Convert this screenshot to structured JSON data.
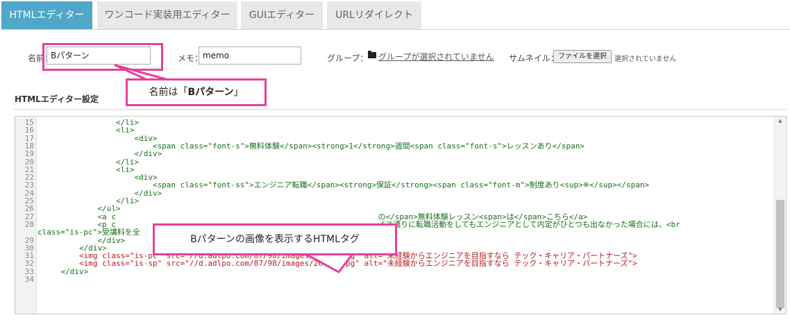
{
  "tabs": [
    {
      "label": "HTMLエディター",
      "active": true
    },
    {
      "label": "ワンコード実装用エディター",
      "active": false
    },
    {
      "label": "GUIエディター",
      "active": false
    },
    {
      "label": "URLリダイレクト",
      "active": false
    }
  ],
  "form": {
    "name_label": "名前：",
    "name_value": "Bパターン",
    "memo_label": "メモ：",
    "memo_value": "memo",
    "group_label": "グループ：",
    "group_link": "グループが選択されていません",
    "thumb_label": "サムネイル：",
    "file_button": "ファイルを選択",
    "file_status": "選択されていません"
  },
  "callouts": {
    "name_prefix": "名前は「",
    "name_bold": "Bパターン",
    "name_suffix": "」",
    "html_tag": "Bパターンの画像を表示するHTMLタグ"
  },
  "section": {
    "title": "HTMLエディター設定"
  },
  "editor": {
    "lines": [
      {
        "n": "15",
        "text": "                </li>"
      },
      {
        "n": "16",
        "text": "                <li>"
      },
      {
        "n": "17",
        "text": "                    <div>"
      },
      {
        "n": "18",
        "text": "                        <span class=\"font-s\">無料体験</span><strong>1</strong>週間<span class=\"font-s\">レッスンあり</span>"
      },
      {
        "n": "19",
        "text": "                    </div>"
      },
      {
        "n": "20",
        "text": "                </li>"
      },
      {
        "n": "21",
        "text": "                <li>"
      },
      {
        "n": "22",
        "text": "                    <div>"
      },
      {
        "n": "23",
        "text": "                        <span class=\"font-ss\">エンジニア転職</span><strong>保証</strong><span class=\"font-m\">制度あり<sup>※</sup></span>"
      },
      {
        "n": "24",
        "text": "                    </div>"
      },
      {
        "n": "25",
        "text": "                </li>"
      },
      {
        "n": "26",
        "text": "            </ul>"
      },
      {
        "n": "27",
        "text": "            <a c                                                         の</span>無料体験レッスン<span>は</span>こちら</a>"
      },
      {
        "n": "28",
        "text": "            <p c                                                         イス通りに転職活動をしてもエンジニアとして内定がひとつも出なかった場合には、<br"
      },
      {
        "n": "",
        "text": "class=\"is-pc\">受講料を全"
      },
      {
        "n": "29",
        "text": "            </div>"
      },
      {
        "n": "30",
        "text": "        </div>"
      },
      {
        "n": "31",
        "text": "        <img class=\"is-pc\" src=\"//d.adlpo.com/87/98/images/26695.jpg\" alt=\"未経験からエンジニアを目指すなら テック・キャリア・パートナーズ\">"
      },
      {
        "n": "32",
        "text": "        <img class=\"is-sp\" src=\"//d.adlpo.com/87/98/images/26696.jpg\" alt=\"未経験からエンジニアを目指すなら テック・キャリア・パートナーズ\">"
      },
      {
        "n": "33",
        "text": "    </div>"
      },
      {
        "n": "34",
        "text": ""
      }
    ]
  },
  "colors": {
    "active_tab": "#4fa7c9",
    "highlight": "#e83e9c",
    "code_green": "#166e16",
    "code_red": "#b8191c"
  }
}
